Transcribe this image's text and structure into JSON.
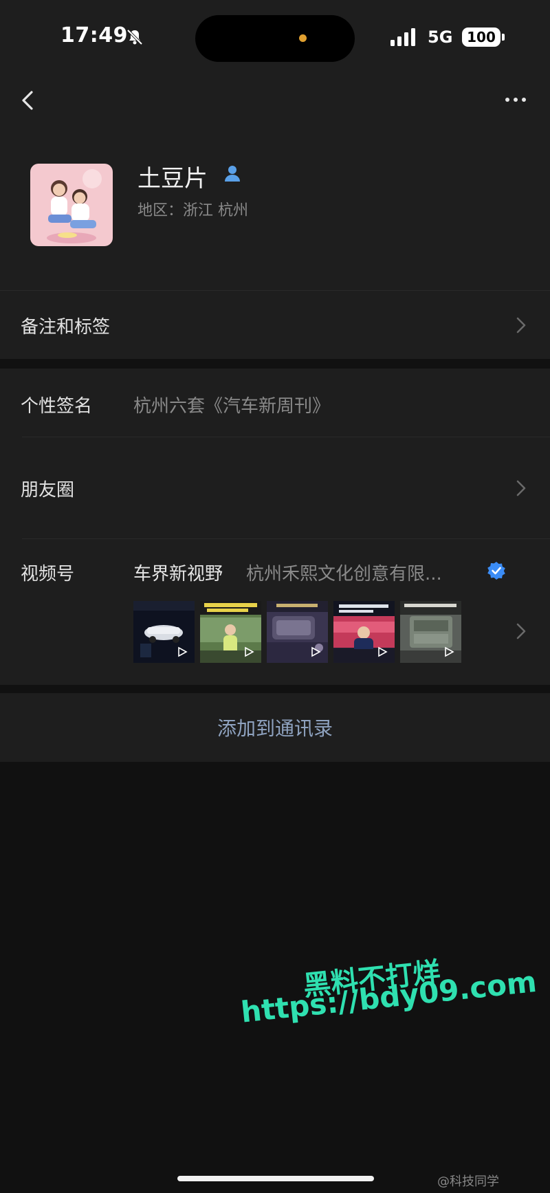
{
  "status_bar": {
    "time": "17:49",
    "network": "5G",
    "battery": "100"
  },
  "profile": {
    "name": "土豆片",
    "region": "地区：浙江 杭州"
  },
  "rows": {
    "notes_label": "备注和标签",
    "signature_label": "个性签名",
    "signature_value": "杭州六套《汽车新周刊》",
    "moments_label": "朋友圈",
    "channels_label": "视频号",
    "channel_name": "车界新视野",
    "channel_org": "杭州禾熙文化创意有限..."
  },
  "actions": {
    "add_contact": "添加到通讯录"
  },
  "watermark": {
    "line1": "黑料不打烊",
    "line2": "https://bdy09.com"
  },
  "weibo_tag": "@科技同学",
  "colors": {
    "background": "#111111",
    "panel": "#1e1e1e",
    "accent_link": "#8fa3c0",
    "verified_blue": "#3b8cf5",
    "watermark": "#2fe0b0"
  }
}
